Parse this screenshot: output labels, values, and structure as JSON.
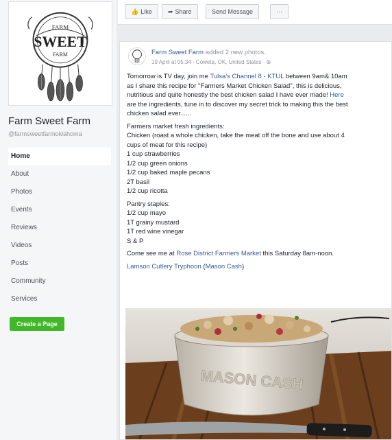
{
  "sidebar": {
    "logo_text": [
      "FARM",
      "SWEET",
      "FARM"
    ],
    "page_name": "Farm Sweet Farm",
    "page_handle": "@farmsweetfarmoklahoma",
    "nav": [
      {
        "label": "Home",
        "active": true
      },
      {
        "label": "About"
      },
      {
        "label": "Photos"
      },
      {
        "label": "Events"
      },
      {
        "label": "Reviews"
      },
      {
        "label": "Videos"
      },
      {
        "label": "Posts"
      },
      {
        "label": "Community"
      },
      {
        "label": "Services"
      }
    ],
    "create_page_label": "Create a Page"
  },
  "action_bar": {
    "like_label": "Like",
    "share_label": "Share",
    "message_label": "Send Message",
    "more_label": "···"
  },
  "post": {
    "author": "Farm Sweet Farm",
    "action_text": "added 2 new photos.",
    "meta": "19 April at 05:34 · Coweta, OK, United States · ⊕",
    "lines": {
      "l1_a": "Tomorrow is TV day, join me ",
      "l1_link": "Tulsa's Channel 8 - KTUL",
      "l1_b": " between 9am& 10am",
      "l2": "as I share this recipe for \"Farmers Market Chicken Salad\", this is delicious,",
      "l3_a": "nutritious and quite honestly the best chicken salad I have ever made! ",
      "l3_link": "Here",
      "l4": "are the ingredients, tune in to discover my secret trick to making this the best",
      "l5": "chicken salad ever......",
      "l6": "Farmers market fresh ingredients:",
      "l7": "Chicken (roast a whole chicken, take the meat off the bone and use about 4",
      "l8": "cups of meat for this recipe)",
      "l9": "1 cup strawberries",
      "l10": "1/2 cup green onions",
      "l11": "1/2 cup baked maple pecans",
      "l12": "2T basil",
      "l13": "1/2 cup ricotta",
      "l14": "Pantry staples:",
      "l15": "1/2 cup mayo",
      "l16": "1T grainy mustard",
      "l17": "1T red wine vinegar",
      "l18": "S & P",
      "l19_a": "Come see me at ",
      "l19_link": "Rose District Farmers Market",
      "l19_b": " this Saturday 8am-noon.",
      "l20_link1": "Lamson Cutlery Tryphoon",
      "l20_mid": " (",
      "l20_link2": "Mason Cash",
      "l20_end": ")"
    },
    "photo_bowl_text": "MASON CASH"
  },
  "colors": {
    "link": "#365899",
    "create_button": "#42b72a",
    "page_bg": "#e9ebee"
  }
}
